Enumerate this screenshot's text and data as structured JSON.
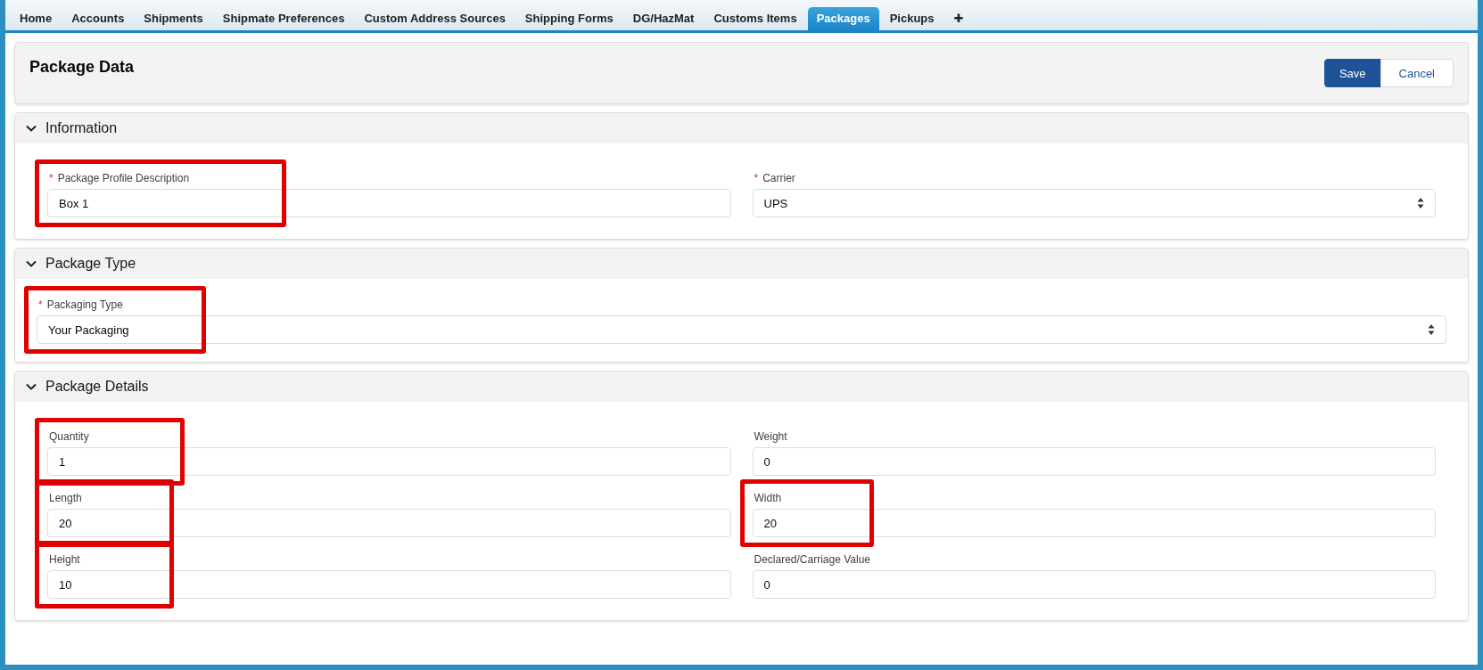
{
  "tabs": [
    {
      "label": "Home",
      "selected": false
    },
    {
      "label": "Accounts",
      "selected": false
    },
    {
      "label": "Shipments",
      "selected": false
    },
    {
      "label": "Shipmate Preferences",
      "selected": false
    },
    {
      "label": "Custom Address Sources",
      "selected": false
    },
    {
      "label": "Shipping Forms",
      "selected": false
    },
    {
      "label": "DG/HazMat",
      "selected": false
    },
    {
      "label": "Customs Items",
      "selected": false
    },
    {
      "label": "Packages",
      "selected": true
    },
    {
      "label": "Pickups",
      "selected": false
    },
    {
      "label": "✚",
      "selected": false
    }
  ],
  "page_header": {
    "title": "Package Data",
    "buttons": [
      {
        "label": "Save",
        "kind": "primary"
      },
      {
        "label": "Cancel",
        "kind": "neutral"
      }
    ]
  },
  "sections": [
    {
      "title": "Information",
      "expanded": true,
      "kind": "two_column",
      "fields": [
        {
          "label": "Package Profile Description",
          "required_mark": "*",
          "value": "Box 1",
          "kind": "text",
          "highlighted": true
        },
        {
          "label": "Carrier",
          "required_mark": "*",
          "value": "UPS",
          "kind": "select",
          "highlighted": false
        }
      ]
    },
    {
      "title": "Package Type",
      "expanded": true,
      "kind": "single",
      "fields": [
        {
          "label": "Packaging Type",
          "required_mark": "*",
          "value": "Your Packaging",
          "kind": "select",
          "highlighted": true
        }
      ]
    },
    {
      "title": "Package Details",
      "expanded": true,
      "kind": "two_column",
      "fields": [
        {
          "label": "Quantity",
          "value": "1",
          "kind": "text",
          "highlighted": true
        },
        {
          "label": "Weight",
          "value": "0",
          "kind": "text",
          "highlighted": false
        },
        {
          "label": "Length",
          "value": "20",
          "kind": "text",
          "highlighted": true
        },
        {
          "label": "Width",
          "value": "20",
          "kind": "text",
          "highlighted": true
        },
        {
          "label": "Height",
          "value": "10",
          "kind": "text",
          "highlighted": true
        },
        {
          "label": "Declared/Carriage Value",
          "value": "0",
          "kind": "text",
          "highlighted": false
        }
      ]
    }
  ]
}
